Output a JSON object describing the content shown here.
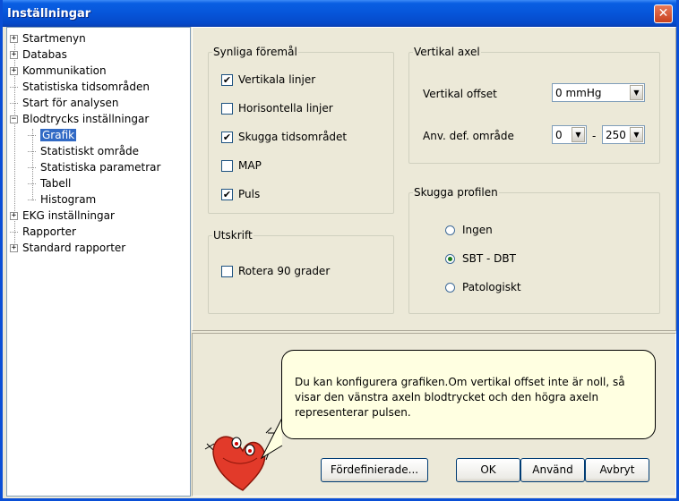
{
  "window": {
    "title": "Inställningar",
    "close": "✕"
  },
  "tree": {
    "items": [
      {
        "label": "Startmenyn",
        "expander": "+"
      },
      {
        "label": "Databas",
        "expander": "+"
      },
      {
        "label": "Kommunikation",
        "expander": "+"
      },
      {
        "label": "Statistiska tidsområden"
      },
      {
        "label": "Start för analysen"
      },
      {
        "label": "Blodtrycks inställningar",
        "expander": "−"
      },
      {
        "label": "Grafik",
        "selected": true
      },
      {
        "label": "Statistiskt område"
      },
      {
        "label": "Statistiska parametrar"
      },
      {
        "label": "Tabell"
      },
      {
        "label": "Histogram"
      },
      {
        "label": "EKG inställningar",
        "expander": "+"
      },
      {
        "label": "Rapporter"
      },
      {
        "label": "Standard rapporter",
        "expander": "+"
      }
    ]
  },
  "visible_items": {
    "legend": "Synliga föremål",
    "options": [
      {
        "label": "Vertikala linjer",
        "checked": true
      },
      {
        "label": "Horisontella linjer",
        "checked": false
      },
      {
        "label": "Skugga tidsområdet",
        "checked": true
      },
      {
        "label": "MAP",
        "checked": false
      },
      {
        "label": "Puls",
        "checked": true
      }
    ]
  },
  "print": {
    "legend": "Utskrift",
    "rotate": {
      "label": "Rotera 90 grader",
      "checked": false
    }
  },
  "vertical_axis": {
    "legend": "Vertikal axel",
    "offset_label": "Vertikal offset",
    "offset_value": "0 mmHg",
    "range_label": "Anv. def. område",
    "range_from": "0",
    "range_sep": "-",
    "range_to": "250"
  },
  "shade_profile": {
    "legend": "Skugga profilen",
    "options": [
      {
        "label": "Ingen",
        "selected": false
      },
      {
        "label": "SBT - DBT",
        "selected": true
      },
      {
        "label": "Patologiskt",
        "selected": false
      }
    ]
  },
  "help": {
    "text": "Du kan konfigurera grafiken.Om vertikal offset inte är noll, så visar den vänstra axeln blodtrycket och den högra axeln representerar pulsen."
  },
  "buttons": {
    "predefined": "Fördefinierade...",
    "ok": "OK",
    "apply": "Använd",
    "cancel": "Avbryt"
  },
  "check_mark": "✔",
  "dropdown_arrow": "▼"
}
